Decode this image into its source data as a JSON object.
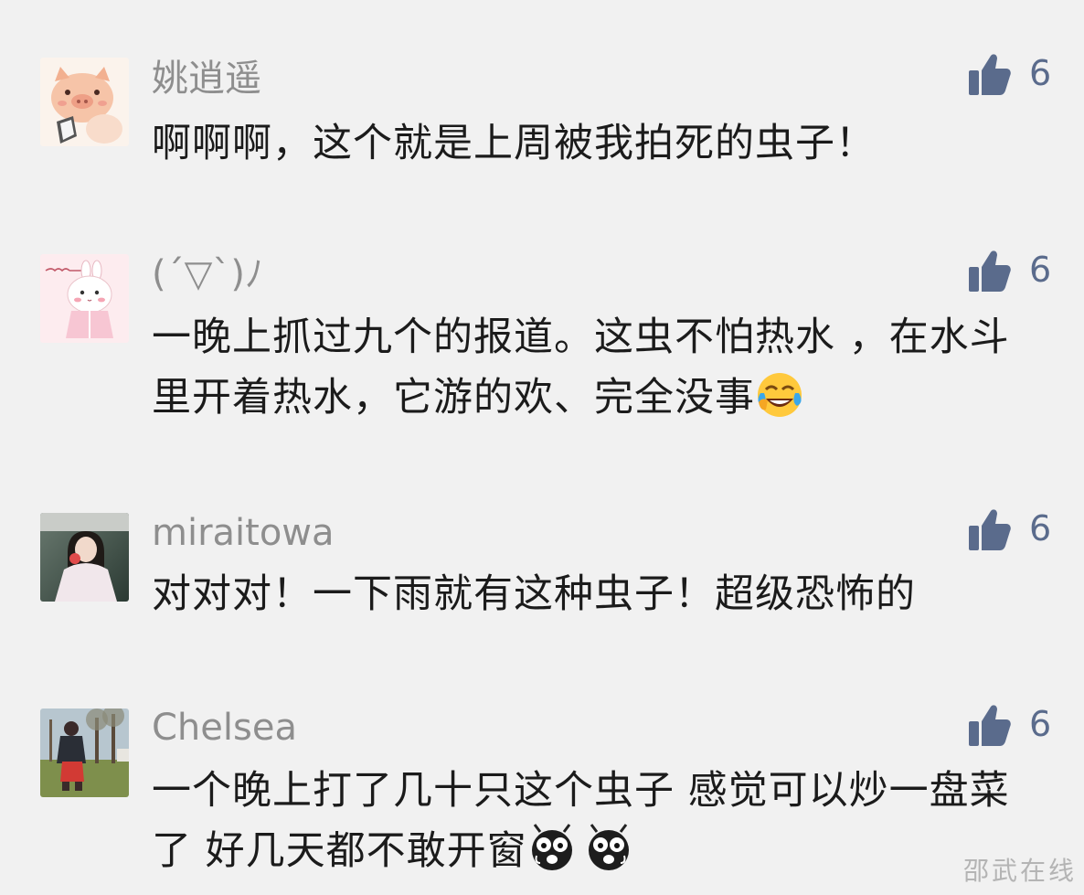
{
  "comments": [
    {
      "username": "姚逍遥",
      "text": "啊啊啊，这个就是上周被我拍死的虫子！",
      "likes": "6",
      "avatar_icon": "pig-avatar-icon"
    },
    {
      "username": "(´▽`)ﾉ",
      "text": "一晚上抓过九个的报道。这虫不怕热水 ，在水斗里开着热水，它游的欢、完全没事",
      "likes": "6",
      "avatar_icon": "bunny-avatar-icon",
      "trailing_emoji": "laugh-cry-emoji-icon"
    },
    {
      "username": "miraitowa",
      "text": "对对对！一下雨就有这种虫子！超级恐怖的",
      "likes": "6",
      "avatar_icon": "girl-photo-avatar-icon"
    },
    {
      "username": "Chelsea",
      "text": "一个晚上打了几十只这个虫子 感觉可以炒一盘菜了 好几天都不敢开窗",
      "likes": "6",
      "avatar_icon": "child-park-photo-avatar-icon",
      "trailing_emoji": "scared-bug-emoji-icon"
    }
  ],
  "watermark": "邵武在线",
  "colors": {
    "background": "#f1f1f1",
    "username": "#8e8e8e",
    "text": "#1b1b1b",
    "like_accent": "#5a6b8c"
  }
}
